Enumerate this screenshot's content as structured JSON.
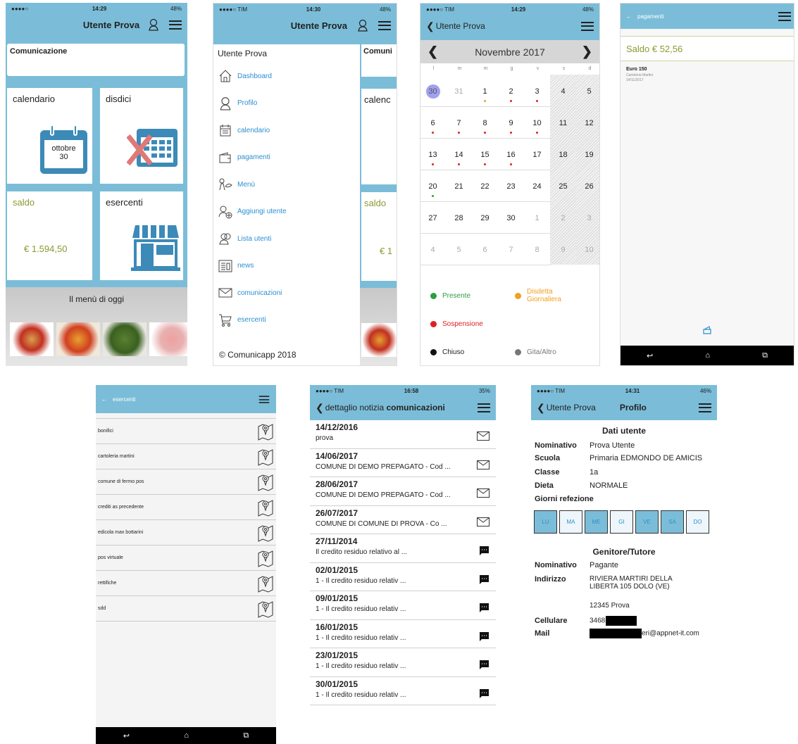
{
  "p1": {
    "status": {
      "carrier": "●●●●○",
      "wifi": "≋",
      "time": "14:29",
      "battery": "48%"
    },
    "title": "Utente Prova",
    "comunicazione": "Comunicazione",
    "tiles": {
      "calendario": "calendario",
      "disdici": "disdici",
      "saldo": "saldo",
      "esercenti": "esercenti"
    },
    "cal_month": "ottobre",
    "cal_day": "30",
    "saldo_value": "€ 1.594,50",
    "menu_title": "Il menù di oggi"
  },
  "p2": {
    "status": {
      "carrier": "●●●●○ TIM",
      "time": "14:30",
      "battery": "48%"
    },
    "title": "Utente Prova",
    "user": "Utente Prova",
    "items": [
      "Dashboard",
      "Profilo",
      "calendario",
      "pagamenti",
      "Menù",
      "Aggiungi utente",
      "Lista utenti",
      "news",
      "comunicazioni",
      "esercenti"
    ],
    "footer": "© Comunicapp 2018",
    "peek": {
      "c": "Comuni",
      "cal": "calenc",
      "saldo": "saldo",
      "val": "€ 1"
    }
  },
  "p3": {
    "status": {
      "carrier": "●●●●○ TIM",
      "time": "14:29",
      "battery": "48%"
    },
    "back": "Utente Prova",
    "month": "Novembre 2017",
    "weekdays": [
      "l",
      "m",
      "m",
      "g",
      "v",
      "s",
      "d"
    ],
    "weeks": [
      [
        "30",
        "31",
        "1",
        "2",
        "3",
        "4",
        "5"
      ],
      [
        "6",
        "7",
        "8",
        "9",
        "10",
        "11",
        "12"
      ],
      [
        "13",
        "14",
        "15",
        "16",
        "17",
        "18",
        "19"
      ],
      [
        "20",
        "21",
        "22",
        "23",
        "24",
        "25",
        "26"
      ],
      [
        "27",
        "28",
        "29",
        "30",
        "1",
        "2",
        "3"
      ],
      [
        "4",
        "5",
        "6",
        "7",
        "8",
        "9",
        "10"
      ]
    ],
    "legend": {
      "presente": "Presente",
      "disdetta": "Disdetta Giornaliera",
      "sospensione": "Sospensione",
      "chiuso": "Chiuso",
      "gita": "Gita/Altro"
    },
    "colors": {
      "presente": "#2e9e3e",
      "disdetta": "#f0a020",
      "sospensione": "#e02020",
      "chiuso": "#111111",
      "gita": "#777777"
    }
  },
  "p4": {
    "title": "pagamenti",
    "saldo": "Saldo € 52,56",
    "entry": {
      "amount": "Euro 150",
      "shop": "Cartoleria Martini",
      "date": "14/11/2017"
    }
  },
  "p5": {
    "title": "esercenti",
    "items": [
      "bonifici",
      "cartoleria martini",
      "comune di fermo pos",
      "crediti as precedente",
      "edicola max bottarini",
      "pos virtuale",
      "rettifiche",
      "sdd"
    ]
  },
  "p6": {
    "status": {
      "carrier": "●●●●○ TIM",
      "time": "16:58",
      "battery": "35%"
    },
    "back": "dettaglio notizia",
    "title": "comunicazioni",
    "news": [
      {
        "date": "14/12/2016",
        "text": "prova",
        "icon": "mail"
      },
      {
        "date": "14/06/2017",
        "text": "COMUNE DI DEMO PREPAGATO - Cod ...",
        "icon": "mail"
      },
      {
        "date": "28/06/2017",
        "text": "COMUNE DI DEMO PREPAGATO - Cod ...",
        "icon": "mail"
      },
      {
        "date": "26/07/2017",
        "text": "COMUNE DI COMUNE DI PROVA - Co ...",
        "icon": "mail"
      },
      {
        "date": "27/11/2014",
        "text": "Il credito residuo relativo al ...",
        "icon": "chat"
      },
      {
        "date": "02/01/2015",
        "text": "1 - Il credito residuo relativ ...",
        "icon": "chat"
      },
      {
        "date": "09/01/2015",
        "text": "1 - Il credito residuo relativ ...",
        "icon": "chat"
      },
      {
        "date": "16/01/2015",
        "text": "1 - Il credito residuo relativ ...",
        "icon": "chat"
      },
      {
        "date": "23/01/2015",
        "text": "1 - Il credito residuo relativ ...",
        "icon": "chat"
      },
      {
        "date": "30/01/2015",
        "text": "1 - Il credito residuo relativ ...",
        "icon": "chat"
      }
    ]
  },
  "p7": {
    "status": {
      "carrier": "●●●●○ TIM",
      "time": "14:31",
      "battery": "46%"
    },
    "back": "Utente Prova",
    "title": "Profilo",
    "dati": "Dati utente",
    "rows": {
      "nominativo_l": "Nominativo",
      "nominativo": "Prova Utente",
      "scuola_l": "Scuola",
      "scuola": "Primaria EDMONDO DE AMICIS",
      "classe_l": "Classe",
      "classe": "1a",
      "dieta_l": "Dieta",
      "dieta": "NORMALE"
    },
    "giorni": "Giorni refezione",
    "days": [
      "LU",
      "MA",
      "ME",
      "GI",
      "VE",
      "SA",
      "DO"
    ],
    "genitore": "Genitore/Tutore",
    "g": {
      "nominativo_l": "Nominativo",
      "nominativo": "Pagante",
      "indirizzo_l": "Indirizzo",
      "indirizzo1": "RIVIERA MARTIRI DELLA",
      "indirizzo2": "LIBERTA 105 DOLO (VE)",
      "indirizzo3": "12345 Prova",
      "cell_l": "Cellulare",
      "cell": "3468",
      "mail_l": "Mail",
      "mail": "eri@appnet-it.com"
    }
  }
}
